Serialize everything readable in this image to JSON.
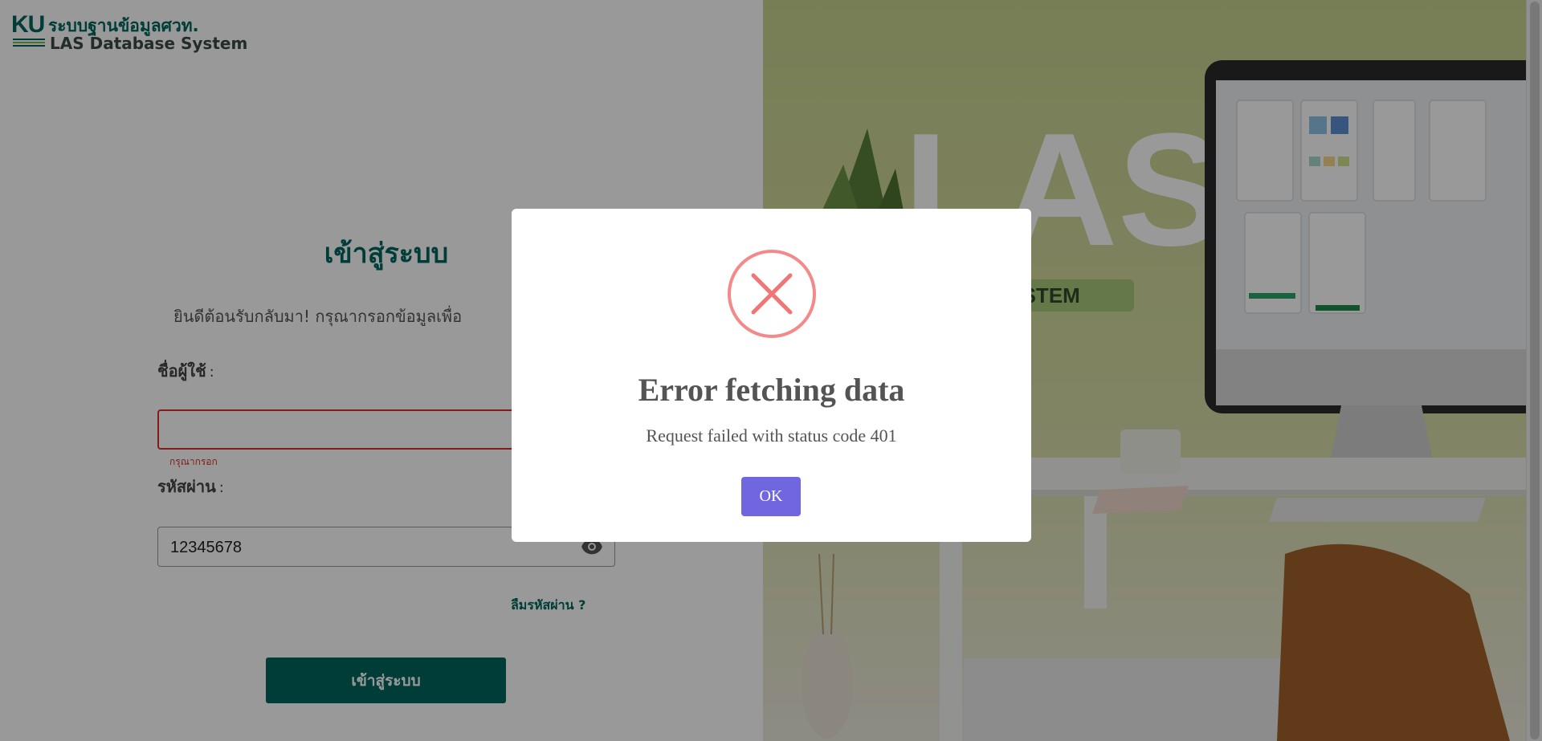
{
  "logo": {
    "ku_text": "KU",
    "thai_name": "ระบบฐานข้อมูลศวท.",
    "english_name": "LAS Database System"
  },
  "login": {
    "title": "เข้าสู่ระบบ",
    "subtitle": "ยินดีต้อนรับกลับมา! กรุณากรอกข้อมูลเพื่อ",
    "username_label": "ชื่อผู้ใช้",
    "password_label": "รหัสผ่าน",
    "label_colon": ":",
    "username_value": "",
    "username_error": "กรุณากรอก",
    "password_value": "12345678",
    "forgot_password": "ลืมรหัสผ่าน ?",
    "submit_label": "เข้าสู่ระบบ"
  },
  "hero": {
    "big_text": "LAS",
    "tag_text": "SE SYSTEM"
  },
  "dialog": {
    "title": "Error fetching data",
    "message": "Request failed with status code 401",
    "ok_label": "OK"
  },
  "colors": {
    "brand_green": "#00665e",
    "error_red": "#d9302b",
    "error_icon": "#f27474",
    "ok_button": "#7066e0"
  }
}
